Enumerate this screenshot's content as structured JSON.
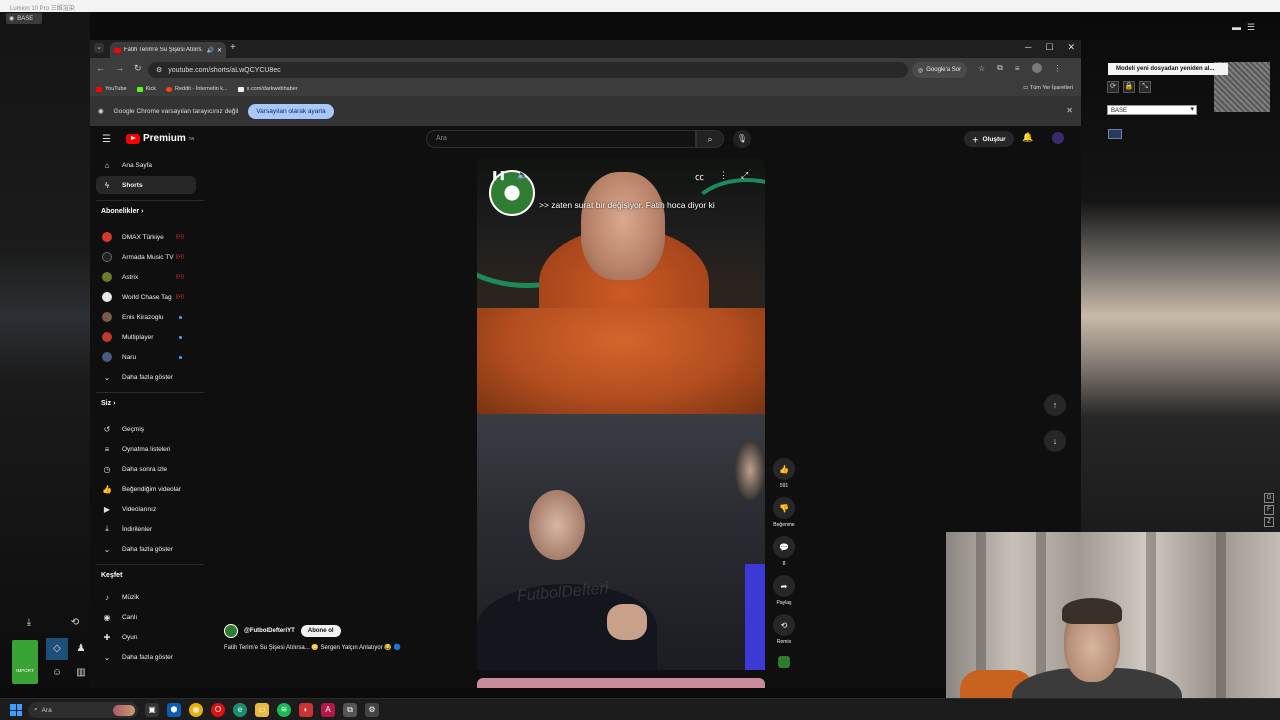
{
  "os": {
    "title": "Lumion 10 Pro 三维渲染",
    "base_tag": "BASE"
  },
  "browser": {
    "tab_title": "Fatih Terim'e Su Şişesi Atılırs...",
    "url": "youtube.com/shorts/aLwQCYCU8ec",
    "google_ask": "Google'a Sor",
    "bookmarks": [
      "YouTube",
      "Kick",
      "Reddit - İnternetin k...",
      "x.com/darkwebhaber"
    ],
    "bookmarks_all": "Tüm Yer İşaretleri",
    "info_text": "Google Chrome varsayılan tarayıcınız değil",
    "info_button": "Varsayılan olarak ayarla"
  },
  "youtube": {
    "logo": "Premium",
    "logo_sup": "TR",
    "search_placeholder": "Ara",
    "create": "Oluştur",
    "nav": [
      {
        "label": "Ana Sayfa",
        "icon": "home-icon"
      },
      {
        "label": "Shorts",
        "icon": "shorts-icon"
      }
    ],
    "subs_header": "Abonelikler",
    "subscriptions": [
      {
        "label": "DMAX Türkiye",
        "color": "#d43b2b",
        "badge": "live"
      },
      {
        "label": "Armada Music TV",
        "color": "#222222",
        "badge": "live"
      },
      {
        "label": "Astrix",
        "color": "#6b7a2a",
        "badge": "live"
      },
      {
        "label": "World Chase Tag",
        "color": "#e8e8e8",
        "badge": "live"
      },
      {
        "label": "Enis Kirazoglu",
        "color": "#7a5a4a",
        "badge": "new"
      },
      {
        "label": "Multiplayer",
        "color": "#c0392b",
        "badge": "new"
      },
      {
        "label": "Naru",
        "color": "#4a5a7a",
        "badge": "new"
      }
    ],
    "subs_more": "Daha fazla göster",
    "you_header": "Siz",
    "you_items": [
      {
        "label": "Geçmiş",
        "icon": "history-icon"
      },
      {
        "label": "Oynatma listeleri",
        "icon": "playlist-icon"
      },
      {
        "label": "Daha sonra izle",
        "icon": "clock-icon"
      },
      {
        "label": "Beğendiğim videolar",
        "icon": "like-icon"
      },
      {
        "label": "Videolarınız",
        "icon": "video-icon"
      },
      {
        "label": "İndirilenler",
        "icon": "download-icon"
      },
      {
        "label": "Daha fazla göster",
        "icon": "chevron-down-icon"
      }
    ],
    "explore_header": "Keşfet",
    "explore_items": [
      {
        "label": "Müzik",
        "icon": "music-icon"
      },
      {
        "label": "Canlı",
        "icon": "live-icon"
      },
      {
        "label": "Oyun",
        "icon": "gamepad-icon"
      },
      {
        "label": "Daha fazla göster",
        "icon": "chevron-down-icon"
      }
    ],
    "short": {
      "caption": ">> zaten surat bir değişiyor. Fatih hoca diyor ki",
      "watermark": "FutbolDefteri",
      "channel": "@FutbolDefteriYT",
      "subscribe": "Abone ol",
      "title": "Fatih Terim'e Su Şişesi Atılırsa... 😳 Sergen Yalçın Anlatıyor 😂 🔵"
    },
    "actions": {
      "likes": "591",
      "dislike": "Beğenme",
      "comments": "8",
      "share": "Paylaş",
      "remix": "Remix"
    }
  },
  "lumion": {
    "tooltip": "Modeli yeni dosyadan yeniden al...",
    "layer_select": "BASE",
    "import_label": "IMPORT",
    "side_letters": [
      "G",
      "F",
      "Z"
    ]
  },
  "taskbar": {
    "search": "Ara"
  }
}
